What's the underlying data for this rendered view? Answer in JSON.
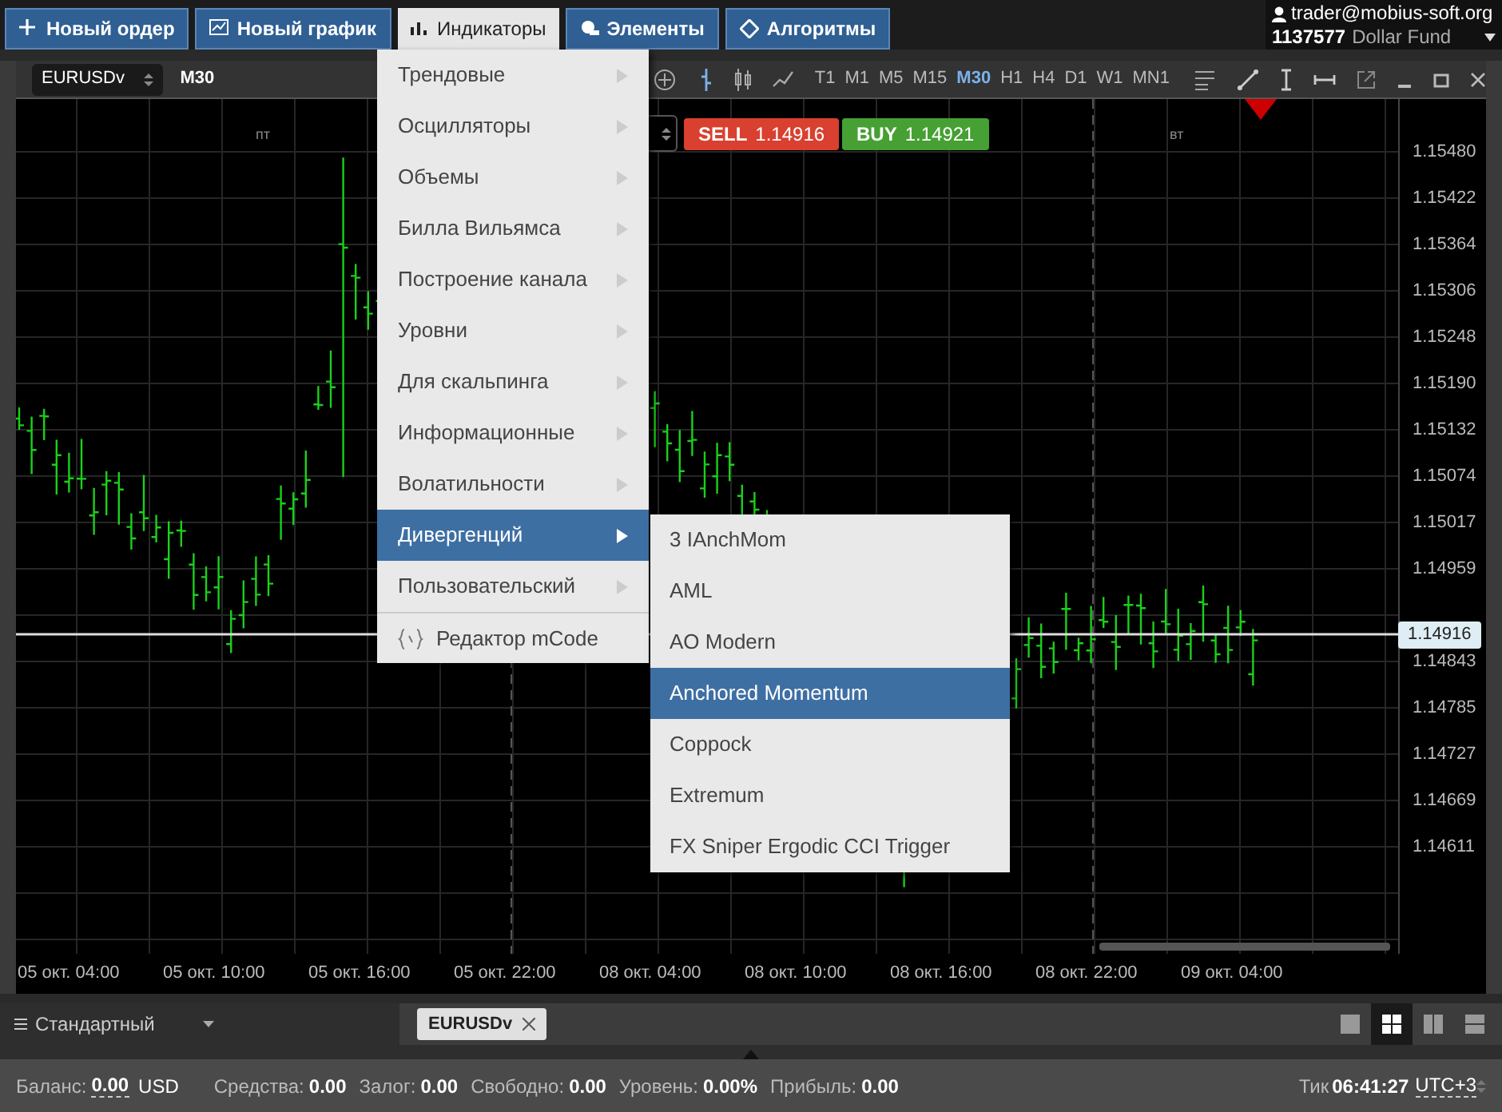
{
  "top_bar": {
    "buttons": [
      {
        "label": "Новый ордер",
        "selected": false
      },
      {
        "label": "Новый график",
        "selected": false
      },
      {
        "label": "Индикаторы",
        "selected": true
      },
      {
        "label": "Элементы",
        "selected": false
      },
      {
        "label": "Алгоритмы",
        "selected": false
      }
    ],
    "account": {
      "user": "trader@mobius-soft.org",
      "number": "1137577",
      "fund": "Dollar Fund"
    }
  },
  "toolbar": {
    "symbol": "EURUSDv",
    "timeframe": "M30",
    "timeframes": [
      {
        "label": "T1",
        "selected": false
      },
      {
        "label": "M1",
        "selected": false
      },
      {
        "label": "M5",
        "selected": false
      },
      {
        "label": "M15",
        "selected": false
      },
      {
        "label": "M30",
        "selected": true
      },
      {
        "label": "H1",
        "selected": false
      },
      {
        "label": "H4",
        "selected": false
      },
      {
        "label": "D1",
        "selected": false
      },
      {
        "label": "W1",
        "selected": false
      },
      {
        "label": "MN1",
        "selected": false
      }
    ]
  },
  "chart": {
    "day_labels": [
      "пт",
      "вт"
    ],
    "sell": {
      "label": "SELL",
      "price": "1.14916"
    },
    "buy": {
      "label": "BUY",
      "price": "1.14921"
    },
    "price_axis": [
      {
        "label": "1.15480"
      },
      {
        "label": "1.15422"
      },
      {
        "label": "1.15364"
      },
      {
        "label": "1.15306"
      },
      {
        "label": "1.15248"
      },
      {
        "label": "1.15190"
      },
      {
        "label": "1.15132"
      },
      {
        "label": "1.15074"
      },
      {
        "label": "1.15017"
      },
      {
        "label": "1.14959"
      },
      {
        "label": "1.14843"
      },
      {
        "label": "1.14785"
      },
      {
        "label": "1.14727"
      },
      {
        "label": "1.14669"
      },
      {
        "label": "1.14611"
      }
    ],
    "current_price": "1.14916",
    "time_axis": [
      "05 окт. 04:00",
      "05 окт. 10:00",
      "05 окт. 16:00",
      "05 окт. 22:00",
      "08 окт. 04:00",
      "08 окт. 10:00",
      "08 окт. 16:00",
      "08 окт. 22:00",
      "09 окт. 04:00"
    ]
  },
  "menu": {
    "items": [
      {
        "label": "Трендовые",
        "kind": "submenu",
        "selected": false
      },
      {
        "label": "Осцилляторы",
        "kind": "submenu",
        "selected": false
      },
      {
        "label": "Объемы",
        "kind": "submenu",
        "selected": false
      },
      {
        "label": "Билла Вильямса",
        "kind": "submenu",
        "selected": false
      },
      {
        "label": "Построение канала",
        "kind": "submenu",
        "selected": false
      },
      {
        "label": "Уровни",
        "kind": "submenu",
        "selected": false
      },
      {
        "label": "Для скальпинга",
        "kind": "submenu",
        "selected": false
      },
      {
        "label": "Информационные",
        "kind": "submenu",
        "selected": false
      },
      {
        "label": "Волатильности",
        "kind": "submenu",
        "selected": false
      },
      {
        "label": "Дивергенций",
        "kind": "submenu",
        "selected": true
      },
      {
        "label": "Пользовательский",
        "kind": "submenu",
        "selected": false
      },
      {
        "label": "Редактор mCode",
        "kind": "editor",
        "selected": false
      }
    ],
    "submenu": [
      {
        "label": "3 IAnchMom",
        "selected": false
      },
      {
        "label": "AML",
        "selected": false
      },
      {
        "label": "AO Modern",
        "selected": false
      },
      {
        "label": "Anchored Momentum",
        "selected": true
      },
      {
        "label": "Coppock",
        "selected": false
      },
      {
        "label": "Extremum",
        "selected": false
      },
      {
        "label": "FX Sniper Ergodic CCI Trigger",
        "selected": false
      }
    ]
  },
  "bottom": {
    "workspace": "Стандартный",
    "tabs": [
      {
        "label": "EURUSDv"
      }
    ],
    "layouts": [
      {
        "kind": "single",
        "selected": false
      },
      {
        "kind": "grid",
        "selected": true
      },
      {
        "kind": "columns",
        "selected": false
      },
      {
        "kind": "rows",
        "selected": false
      }
    ]
  },
  "status": {
    "fields": [
      {
        "label": "Баланс:",
        "value": "0.00",
        "unit": "USD"
      },
      {
        "label": "Средства:",
        "value": "0.00"
      },
      {
        "label": "Залог:",
        "value": "0.00"
      },
      {
        "label": "Свободно:",
        "value": "0.00"
      },
      {
        "label": "Уровень:",
        "value": "0.00%"
      },
      {
        "label": "Прибыль:",
        "value": "0.00"
      }
    ],
    "tick_label": "Тик",
    "tick_time": "06:41:27",
    "timezone": "UTC+3"
  }
}
